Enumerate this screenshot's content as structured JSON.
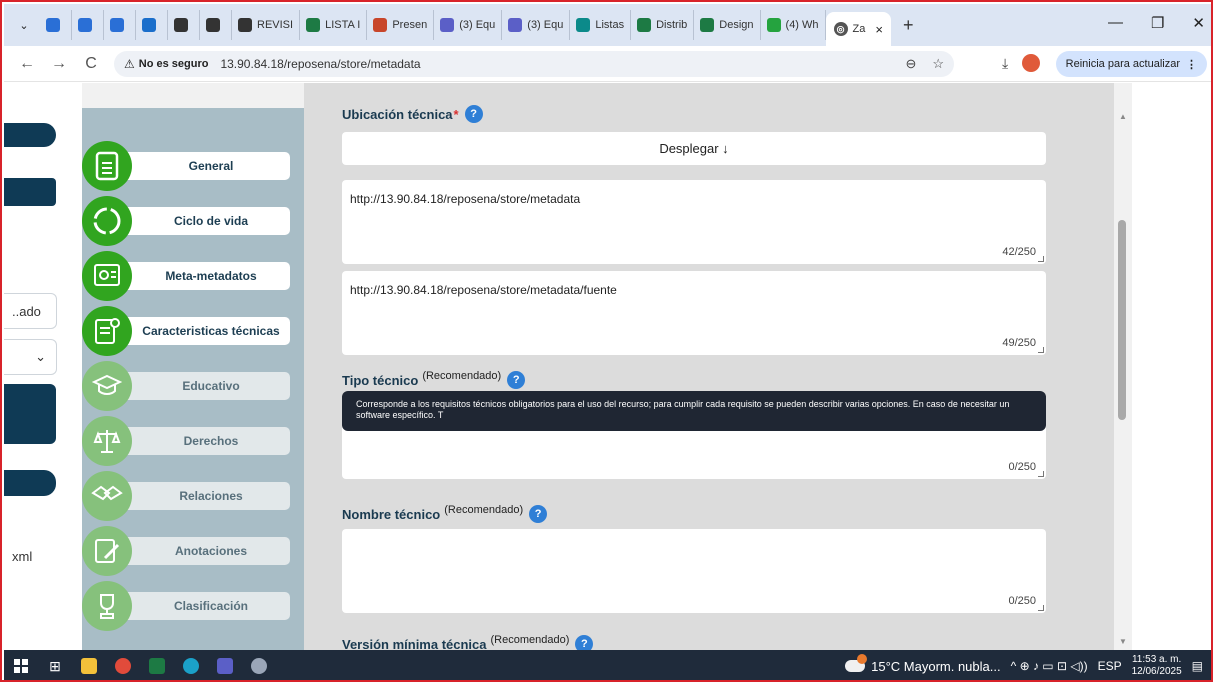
{
  "browser": {
    "tabs": [
      {
        "label": "",
        "color": "#2a6fd6",
        "icon": "outlook-icon"
      },
      {
        "label": "",
        "color": "#2a6fd6",
        "icon": "outlook-icon"
      },
      {
        "label": "",
        "color": "#2a6fd6",
        "icon": "app-icon"
      },
      {
        "label": "",
        "color": "#1a6ecb",
        "icon": "cloud-icon"
      },
      {
        "label": "",
        "color": "#333333",
        "icon": "g-icon"
      },
      {
        "label": "",
        "color": "#333333",
        "icon": "globe-icon"
      },
      {
        "label": "REVISI",
        "color": "#333333",
        "icon": "globe-icon"
      },
      {
        "label": "LISTA I",
        "color": "#1d7a44",
        "icon": "excel-icon"
      },
      {
        "label": "Presen",
        "color": "#c8462a",
        "icon": "powerpoint-icon"
      },
      {
        "label": "(3) Equ",
        "color": "#5b5fc7",
        "icon": "teams-icon"
      },
      {
        "label": "(3) Equ",
        "color": "#5b5fc7",
        "icon": "teams-icon"
      },
      {
        "label": "Listas",
        "color": "#0b8a8a",
        "icon": "sharepoint-icon"
      },
      {
        "label": "Distrib",
        "color": "#1d7a44",
        "icon": "excel-icon"
      },
      {
        "label": "Design",
        "color": "#1d7a44",
        "icon": "excel-icon"
      },
      {
        "label": "(4) Wh",
        "color": "#25a33f",
        "icon": "whatsapp-icon"
      }
    ],
    "active_tab": {
      "label": "Za",
      "close": "×"
    },
    "new_tab": "+",
    "window_controls": {
      "minimize": "—",
      "restore": "❐",
      "close": "✕"
    },
    "nav": {
      "back": "←",
      "forward": "→",
      "reload": "C"
    },
    "security_label": "No es seguro",
    "url": "13.90.84.18/reposena/store/metadata",
    "update_button": "Reinicia para actualizar"
  },
  "left_partial": {
    "select_value": "..ado",
    "select_chevron": "⌄",
    "xml_text": "xml"
  },
  "sidebar": {
    "items": [
      {
        "label": "General",
        "icon": "document-icon",
        "active": true
      },
      {
        "label": "Ciclo de vida",
        "icon": "cycle-icon",
        "active": true
      },
      {
        "label": "Meta-metadatos",
        "icon": "certificate-icon",
        "active": true
      },
      {
        "label": "Caracteristicas técnicas",
        "icon": "tech-doc-icon",
        "active": true
      },
      {
        "label": "Educativo",
        "icon": "graduation-icon",
        "active": false
      },
      {
        "label": "Derechos",
        "icon": "scales-icon",
        "active": false
      },
      {
        "label": "Relaciones",
        "icon": "handshake-icon",
        "active": false
      },
      {
        "label": "Anotaciones",
        "icon": "edit-icon",
        "active": false
      },
      {
        "label": "Clasificación",
        "icon": "trophy-icon",
        "active": false
      }
    ]
  },
  "form": {
    "ubicacion": {
      "label": "Ubicación técnica",
      "required_mark": "*",
      "help": "?",
      "deploy_button": "Desplegar ↓",
      "entries": [
        {
          "value": "http://13.90.84.18/reposena/store/metadata",
          "count": "42/250"
        },
        {
          "value": "http://13.90.84.18/reposena/store/metadata/fuente",
          "count": "49/250"
        }
      ]
    },
    "tipo": {
      "label": "Tipo técnico",
      "recommended": "(Recomendado)",
      "help": "?",
      "tooltip": "Corresponde a los requisitos técnicos obligatorios para el uso del recurso; para cumplir cada requisito se pueden describir varias opciones. En caso de necesitar un software específico. T",
      "count": "0/250"
    },
    "nombre": {
      "label": "Nombre técnico",
      "recommended": "(Recomendado)",
      "help": "?",
      "count": "0/250"
    },
    "version": {
      "label": "Versión mínima técnica",
      "recommended": "(Recomendado)",
      "help": "?"
    }
  },
  "taskbar": {
    "weather": "15°C  Mayorm. nubla...",
    "lang": "ESP",
    "time": "11:53 a. m.",
    "date": "12/06/2025",
    "tray_icons": "^ ⊕ ♪ ▭ ⊡ ◁))"
  }
}
